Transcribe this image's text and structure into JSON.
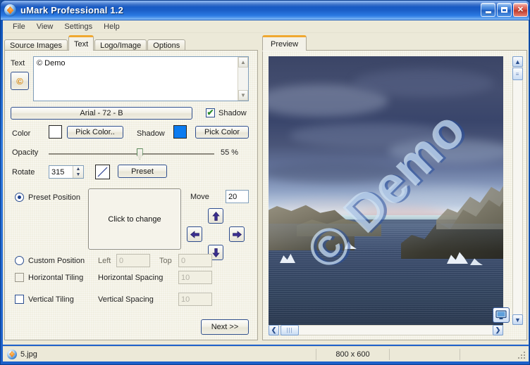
{
  "window": {
    "title": "uMark Professional 1.2",
    "icon": "app-logo-icon",
    "minimize_label": "Minimize",
    "maximize_label": "Maximize",
    "close_label": "Close"
  },
  "menubar": {
    "items": [
      {
        "label": "File"
      },
      {
        "label": "View"
      },
      {
        "label": "Settings"
      },
      {
        "label": "Help"
      }
    ]
  },
  "tabs": {
    "items": [
      {
        "label": "Source Images",
        "active": false
      },
      {
        "label": "Text",
        "active": true
      },
      {
        "label": "Logo/Image",
        "active": false
      },
      {
        "label": "Options",
        "active": false
      }
    ]
  },
  "text_tab": {
    "text_label": "Text",
    "text_value": "© Demo",
    "copyright_button_label": "©",
    "font_button_label": "Arial - 72 - B",
    "shadow_checkbox_label": "Shadow",
    "shadow_checked": true,
    "color_label": "Color",
    "color_value": "#ffffff",
    "pick_color_label": "Pick Color..",
    "shadow_label": "Shadow",
    "shadow_color_value": "#0b7bf0",
    "pick_shadow_color_label": "Pick Color",
    "opacity_label": "Opacity",
    "opacity_value": "55 %",
    "opacity_percent": 55,
    "rotate_label": "Rotate",
    "rotate_value": "315",
    "preset_button_label": "Preset",
    "preset_position_label": "Preset Position",
    "preset_position_selected": true,
    "preset_box_label": "Click to change",
    "move_label": "Move",
    "move_value": "20",
    "arrow_left": "arrow-left-icon",
    "arrow_up": "arrow-up-icon",
    "arrow_down": "arrow-down-icon",
    "arrow_right": "arrow-right-icon",
    "custom_position_label": "Custom Position",
    "custom_position_selected": false,
    "left_label": "Left",
    "left_value": "0",
    "top_label": "Top",
    "top_value": "0",
    "horizontal_tiling_label": "Horizontal Tiling",
    "horizontal_tiling_checked": false,
    "horizontal_spacing_label": "Horizontal Spacing",
    "horizontal_spacing_value": "10",
    "vertical_tiling_label": "Vertical Tiling",
    "vertical_tiling_checked": false,
    "vertical_spacing_label": "Vertical Spacing",
    "vertical_spacing_value": "10",
    "next_button_label": "Next >>"
  },
  "preview": {
    "tab_label": "Preview",
    "watermark_text": "© Demo",
    "watermark_rotation_deg": 315,
    "fit_button_label": "fit-to-window-icon",
    "scroll_up": "▲",
    "scroll_down": "▼",
    "scroll_left": "❮",
    "scroll_right": "❯"
  },
  "statusbar": {
    "filename": "5.jpg",
    "file_icon": "app-logo-icon",
    "dimensions": "800 x 600",
    "cell3": "",
    "cell4": ""
  }
}
